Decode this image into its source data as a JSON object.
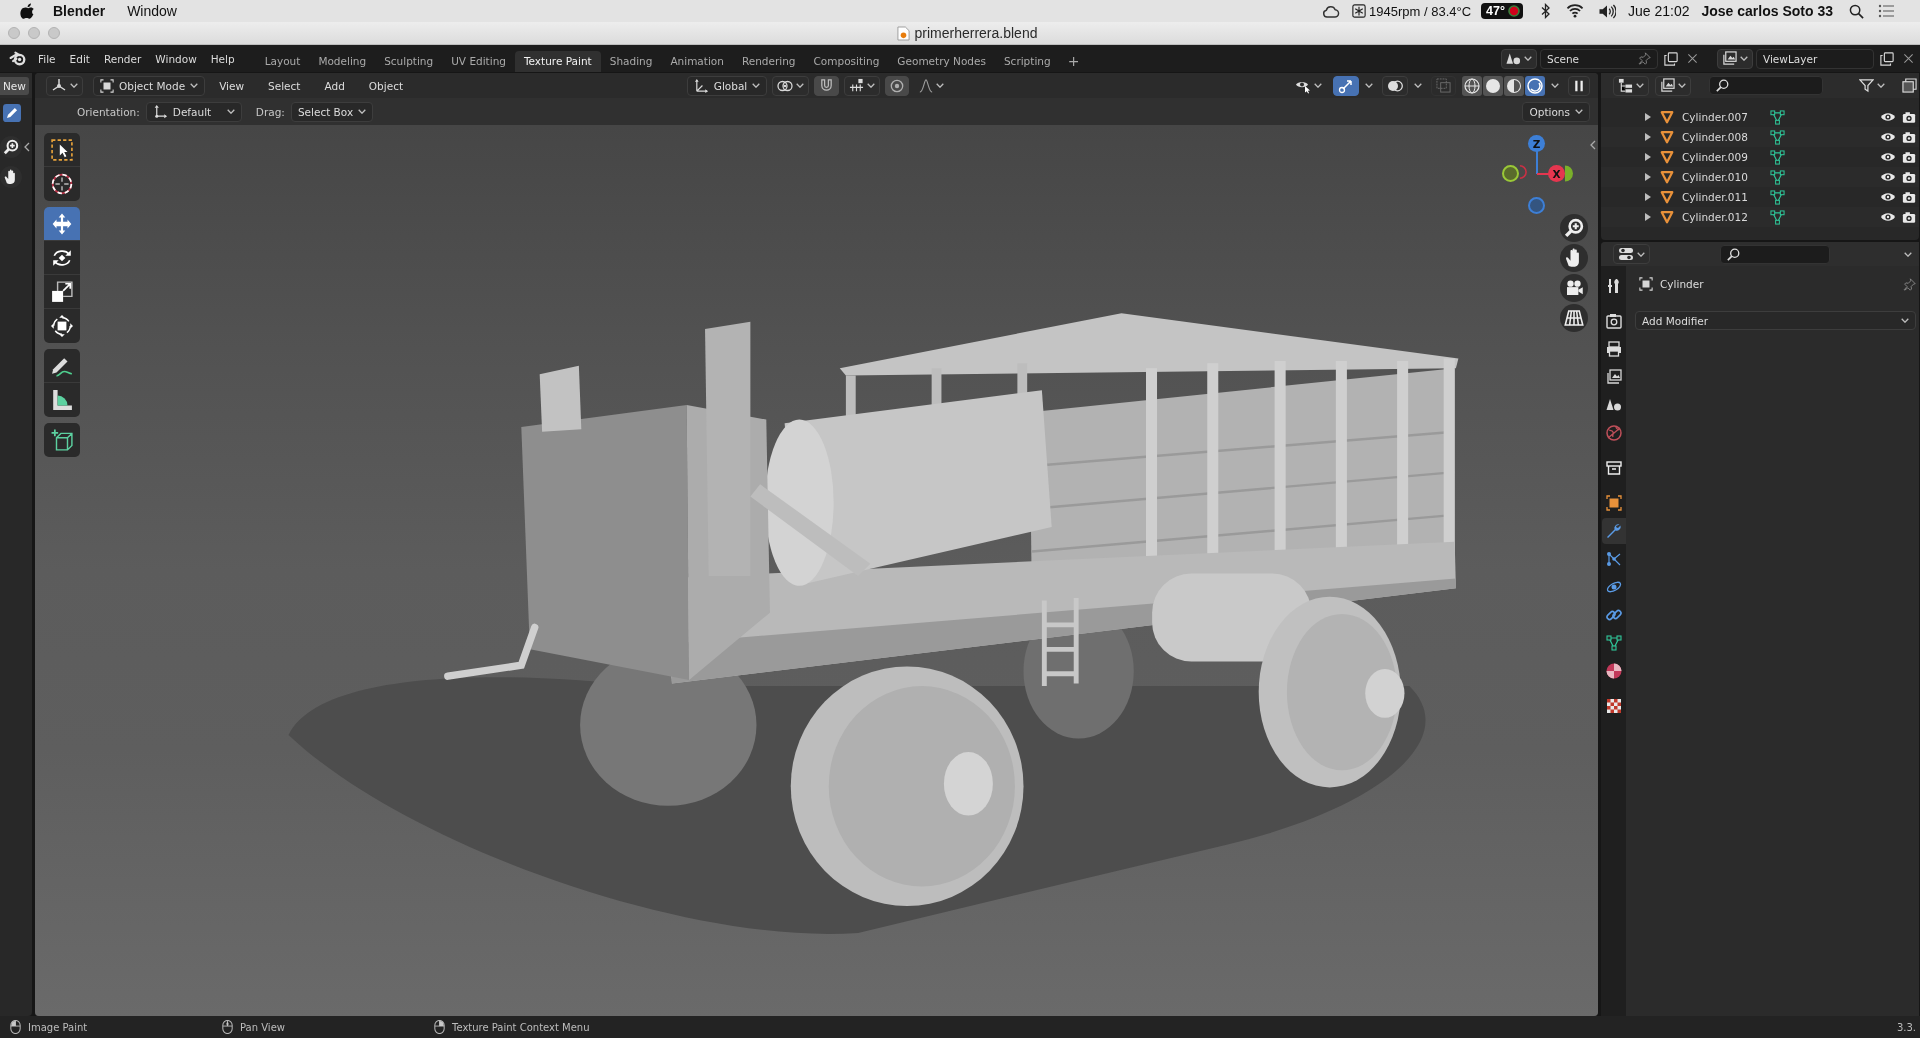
{
  "mac_menubar": {
    "app_name": "Blender",
    "menus": [
      "Window"
    ],
    "fan_reading": "1945rpm / 83.4°C",
    "temperature": "47°",
    "clock": "Jue 21:02",
    "user": "Jose carlos Soto 33"
  },
  "window": {
    "title": "primerherrera.blend"
  },
  "topbar": {
    "menus": [
      "File",
      "Edit",
      "Render",
      "Window",
      "Help"
    ],
    "workspaces": [
      {
        "label": "Layout",
        "selected": false
      },
      {
        "label": "Modeling",
        "selected": false
      },
      {
        "label": "Sculpting",
        "selected": false
      },
      {
        "label": "UV Editing",
        "selected": false
      },
      {
        "label": "Texture Paint",
        "selected": true
      },
      {
        "label": "Shading",
        "selected": false
      },
      {
        "label": "Animation",
        "selected": false
      },
      {
        "label": "Rendering",
        "selected": false
      },
      {
        "label": "Compositing",
        "selected": false
      },
      {
        "label": "Geometry Nodes",
        "selected": false
      },
      {
        "label": "Scripting",
        "selected": false
      }
    ],
    "add_workspace": "+",
    "scene": "Scene",
    "view_layer": "ViewLayer"
  },
  "image_editor": {
    "new_button": "New",
    "brush_tool": {
      "selected": true
    }
  },
  "viewport": {
    "header": {
      "mode": "Object Mode",
      "menus": [
        "View",
        "Select",
        "Add",
        "Object"
      ],
      "orientation": "Global",
      "toggles": [
        {
          "kind": "gizmo",
          "on": true
        },
        {
          "kind": "overlays",
          "on": false
        }
      ],
      "xray": {
        "disabled": true
      },
      "shading": [
        {
          "kind": "wireframe",
          "selected": false
        },
        {
          "kind": "solid",
          "selected": false
        },
        {
          "kind": "material",
          "selected": false
        },
        {
          "kind": "rendered",
          "selected": true
        }
      ]
    },
    "tool_settings": {
      "orientation_label": "Orientation:",
      "orientation": "Default",
      "drag_label": "Drag:",
      "drag": "Select Box",
      "options": "Options"
    },
    "tools": [
      {
        "kind": "select_box",
        "selected": false
      },
      {
        "kind": "cursor",
        "selected": false
      },
      {
        "kind": "move",
        "selected": true
      },
      {
        "kind": "rotate",
        "selected": false
      },
      {
        "kind": "scale",
        "selected": false
      },
      {
        "kind": "transform",
        "selected": false
      },
      {
        "kind": "annotate",
        "selected": false
      },
      {
        "kind": "measure",
        "selected": false
      },
      {
        "kind": "add_cube",
        "selected": false
      }
    ],
    "gizmo": {
      "axes": [
        {
          "kind": "z",
          "label": "Z"
        },
        {
          "kind": "x",
          "label": "X"
        }
      ]
    }
  },
  "outliner": {
    "rows": [
      {
        "name": "Cylinder.007"
      },
      {
        "name": "Cylinder.008"
      },
      {
        "name": "Cylinder.009"
      },
      {
        "name": "Cylinder.010"
      },
      {
        "name": "Cylinder.011"
      },
      {
        "name": "Cylinder.012"
      }
    ]
  },
  "properties": {
    "tabs": [
      {
        "kind": "tool",
        "selected": false
      },
      {
        "kind": "render",
        "selected": false
      },
      {
        "kind": "output",
        "selected": false
      },
      {
        "kind": "view_layer",
        "selected": false
      },
      {
        "kind": "scene",
        "selected": false
      },
      {
        "kind": "world",
        "selected": false
      },
      {
        "kind": "collection",
        "selected": false
      },
      {
        "kind": "object",
        "selected": false
      },
      {
        "kind": "modifiers",
        "selected": true
      },
      {
        "kind": "particles",
        "selected": false
      },
      {
        "kind": "physics",
        "selected": false
      },
      {
        "kind": "constraints",
        "selected": false
      },
      {
        "kind": "data",
        "selected": false
      },
      {
        "kind": "material",
        "selected": false
      },
      {
        "kind": "texture",
        "selected": false
      }
    ],
    "object_name": "Cylinder",
    "add_modifier": "Add Modifier"
  },
  "status_bar": {
    "hints": [
      {
        "kind": "left",
        "label": "Image Paint"
      },
      {
        "kind": "middle",
        "label": "Pan View"
      },
      {
        "kind": "right",
        "label": "Texture Paint Context Menu"
      }
    ],
    "version": "3.3."
  }
}
